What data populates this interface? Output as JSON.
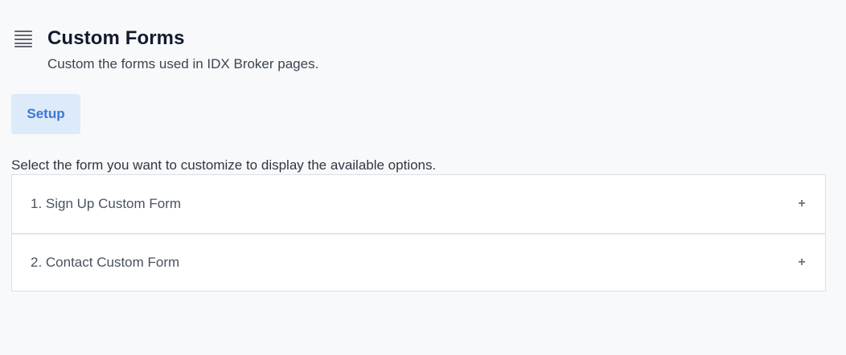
{
  "header": {
    "icon": "list-icon",
    "title": "Custom Forms",
    "subtitle": "Custom the forms used in IDX Broker pages."
  },
  "tabs": [
    {
      "label": "Setup",
      "active": true
    }
  ],
  "instructions": "Select the form you want to customize to display the available options.",
  "forms": [
    {
      "label": "1. Sign Up Custom Form",
      "toggle": "+",
      "expanded": false
    },
    {
      "label": "2. Contact Custom Form",
      "toggle": "+",
      "expanded": false
    }
  ],
  "colors": {
    "background": "#f8f9fa",
    "accent": "#3d77d6",
    "tab_background": "#dceaf9",
    "title": "#121a2e"
  }
}
